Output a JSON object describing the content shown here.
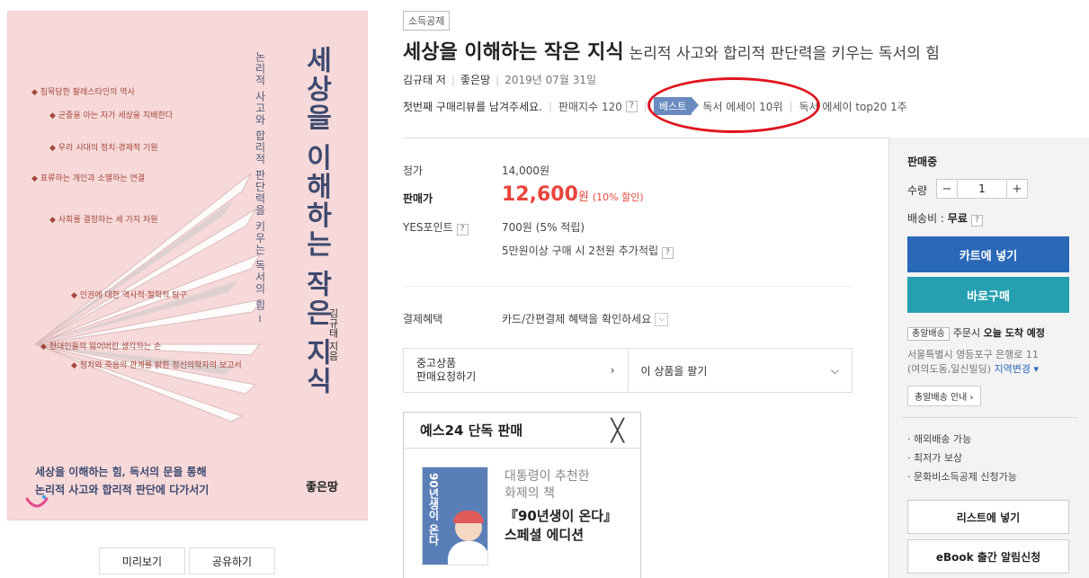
{
  "cover": {
    "title_vertical": "세상을 이해하는 작은 지식",
    "subtitle_vertical": "논리적 사고와 합리적 판단력을 키우는 독서의 힘 ─",
    "author_vertical": "김규태 지음",
    "bullets": [
      "◆ 침묵당한 팔레스타인의 역사",
      "◆ 군중을 아는 자가 세상을 지배한다",
      "◆ 우리 시대의 정치·경제적 기원",
      "◆ 표류하는 개인과 소멸하는 연결",
      "◆ 사회를 결정하는 세 가지 차원",
      "◆ 인권에 대한 역사적·철학적 탐구",
      "◆ 현대인들의 잃어버린 생각하는 손",
      "◆ 정치와 죽음의 관계를 밝힌 정신의학자의 보고서"
    ],
    "bottom_line1": "세상을 이해하는 힘, 독서의 문을 통해",
    "bottom_line2": "논리적 사고와 합리적 판단에 다가서기",
    "publisher_logo": "좋은땅",
    "preview_btn": "미리보기",
    "share_btn": "공유하기"
  },
  "header": {
    "badge": "소득공제",
    "title": "세상을 이해하는 작은 지식",
    "subtitle": "논리적 사고와 합리적 판단력을 키우는 독서의 힘",
    "author": "김규태 저",
    "publisher": "좋은땅",
    "date": "2019년 07월 31일",
    "review_prompt": "첫번째 구매리뷰를 남겨주세요.",
    "sales_index": "판매지수 120",
    "best_tag": "베스트",
    "rank1": "독서 에세이 10위",
    "rank2": "독서 에세이 top20 1주"
  },
  "price": {
    "list_label": "정가",
    "list_value": "14,000원",
    "sale_label": "판매가",
    "sale_value": "12,600",
    "sale_unit": "원",
    "discount": "(10% 할인)",
    "points_label": "YES포인트",
    "points_value": "700원 (5% 적립)",
    "points_extra": "5만원이상 구매 시 2천원 추가적립",
    "payment_label": "결제혜택",
    "payment_value": "카드/간편결제 혜택을 확인하세요",
    "used_line1": "중고상품",
    "used_line2": "판매요청하기",
    "sell_label": "이 상품을 팔기"
  },
  "exclusive": {
    "title": "예스24 단독 판매",
    "close": "╳",
    "desc_line1": "대통령이 추천한",
    "desc_line2": "화제의 책",
    "book_line1": "『90년생이 온다』",
    "book_line2": "스페셜 에디션",
    "mini_title": "90년생이 온다"
  },
  "panel": {
    "status": "판매중",
    "qty_label": "수량",
    "qty_minus": "−",
    "qty_value": "1",
    "qty_plus": "+",
    "ship_label": "배송비 : ",
    "ship_value": "무료",
    "cart_btn": "카트에 넣기",
    "buy_btn": "바로구매",
    "fast_tag": "총알배송",
    "fast_prefix": "주문시 ",
    "fast_bold": "오늘 도착 예정",
    "addr_line1": "서울특별시 영등포구 은행로 11",
    "addr_line2": "(여의도동,일신빌딩)",
    "addr_change": "지역변경 ▾",
    "fast_guide": "총알배송 안내 ›",
    "services": [
      "· 해외배송 가능",
      "· 최저가 보상",
      "· 문화비소득공제 신청가능"
    ],
    "wish_btn": "리스트에 넣기",
    "ebook_btn": "eBook 출간 알림신청"
  }
}
